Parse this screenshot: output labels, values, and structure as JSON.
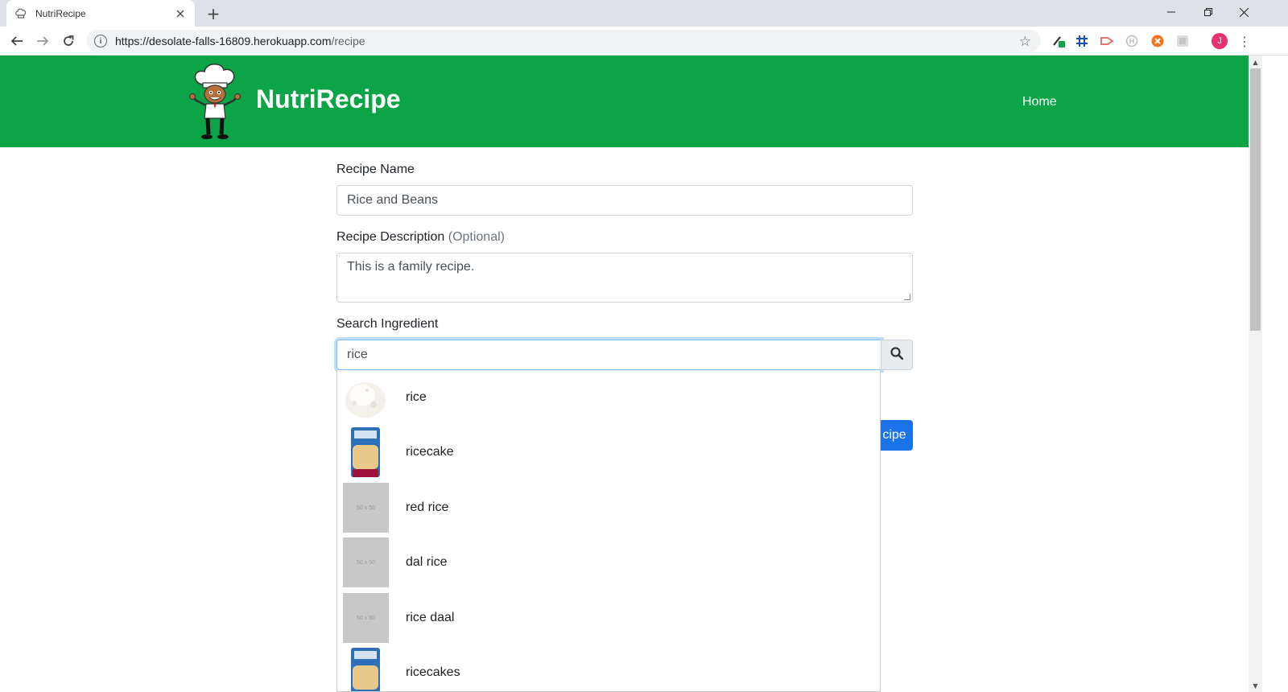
{
  "browser": {
    "tab_title": "NutriRecipe",
    "new_tab_glyph": "+",
    "url_host": "https://desolate-falls-16809.herokuapp.com",
    "url_path": "/recipe",
    "window_controls": [
      "minimize-icon",
      "restore-icon",
      "close-icon"
    ],
    "profile_initial": "J"
  },
  "header": {
    "brand": "NutriRecipe",
    "nav_home": "Home",
    "colors": {
      "header_bg": "#0ba547",
      "primary_button": "#1a73e8"
    }
  },
  "form": {
    "recipe_name_label": "Recipe Name",
    "recipe_name_value": "Rice and Beans",
    "description_label": "Recipe Description",
    "description_optional": "(Optional)",
    "description_value": "This is a family recipe.",
    "search_label": "Search Ingredient",
    "search_value": "rice",
    "save_button_visible_text": "cipe"
  },
  "suggestions": [
    {
      "name": "rice",
      "thumb": "rice-photo"
    },
    {
      "name": "ricecake",
      "thumb": "ricecake-package"
    },
    {
      "name": "red rice",
      "thumb": "placeholder",
      "placeholder_text": "50 x 50"
    },
    {
      "name": "dal rice",
      "thumb": "placeholder",
      "placeholder_text": "50 x 50"
    },
    {
      "name": "rice daal",
      "thumb": "placeholder",
      "placeholder_text": "50 x 50"
    },
    {
      "name": "ricecakes",
      "thumb": "ricecake-package"
    }
  ]
}
